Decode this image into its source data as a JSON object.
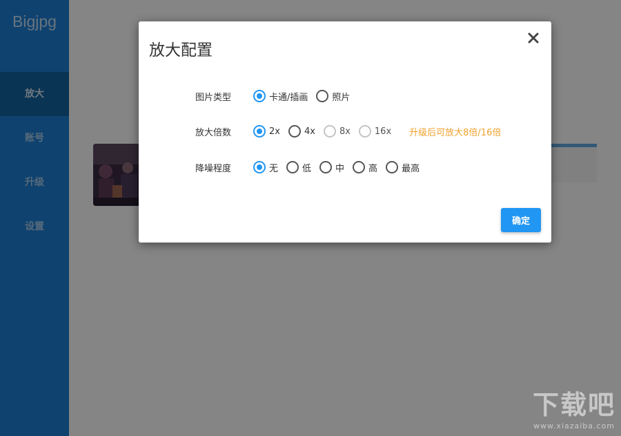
{
  "app": {
    "logo": "Bigjpg"
  },
  "sidebar": {
    "items": [
      {
        "label": "放大",
        "active": true
      },
      {
        "label": "账号",
        "active": false
      },
      {
        "label": "升级",
        "active": false
      },
      {
        "label": "设置",
        "active": false
      }
    ]
  },
  "modal": {
    "title": "放大配置",
    "close_icon": "close-icon",
    "image_type": {
      "label": "图片类型",
      "options": [
        {
          "label": "卡通/插画",
          "checked": true
        },
        {
          "label": "照片",
          "checked": false
        }
      ]
    },
    "scale": {
      "label": "放大倍数",
      "options": [
        {
          "label": "2x",
          "checked": true,
          "disabled": false
        },
        {
          "label": "4x",
          "checked": false,
          "disabled": false
        },
        {
          "label": "8x",
          "checked": false,
          "disabled": true
        },
        {
          "label": "16x",
          "checked": false,
          "disabled": true
        }
      ],
      "upgrade_note": "升级后可放大8倍/16倍"
    },
    "noise": {
      "label": "降噪程度",
      "options": [
        {
          "label": "无",
          "checked": true
        },
        {
          "label": "低",
          "checked": false
        },
        {
          "label": "中",
          "checked": false
        },
        {
          "label": "高",
          "checked": false
        },
        {
          "label": "最高",
          "checked": false
        }
      ]
    },
    "confirm_label": "确定"
  },
  "colors": {
    "sidebar": "#1d7fd5",
    "sidebar_active": "#14649f",
    "accent": "#2196f3",
    "upgrade_note": "#f0a22c"
  },
  "watermark": {
    "text": "下载吧",
    "subtext": "www.xiazaiba.com"
  }
}
